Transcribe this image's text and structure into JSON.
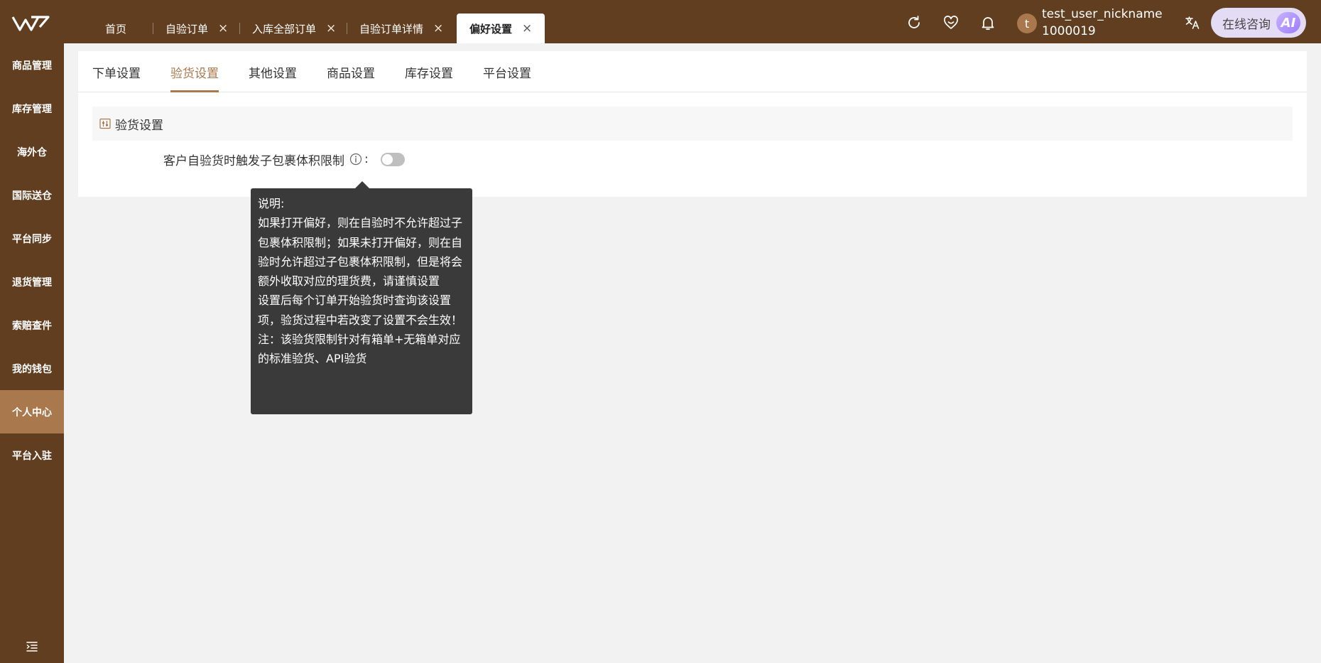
{
  "header": {
    "tabs": [
      {
        "label": "首页",
        "closable": false,
        "active": false
      },
      {
        "label": "自验订单",
        "closable": true,
        "active": false
      },
      {
        "label": "入库全部订单",
        "closable": true,
        "active": false
      },
      {
        "label": "自验订单详情",
        "closable": true,
        "active": false
      },
      {
        "label": "偏好设置",
        "closable": true,
        "active": true
      }
    ],
    "close_glyph": "×",
    "icons": [
      "refresh-icon",
      "heart-icon",
      "bell-icon",
      "translate-icon"
    ],
    "user": {
      "avatar_letter": "t",
      "nickname": "test_user_nickname",
      "id": "1000019"
    },
    "consult_label": "在线咨询",
    "ai_label": "AI"
  },
  "sidebar": {
    "items": [
      {
        "label": "商品管理",
        "active": false
      },
      {
        "label": "库存管理",
        "active": false
      },
      {
        "label": "海外仓",
        "active": false
      },
      {
        "label": "国际送仓",
        "active": false
      },
      {
        "label": "平台同步",
        "active": false
      },
      {
        "label": "退货管理",
        "active": false
      },
      {
        "label": "索赔查件",
        "active": false
      },
      {
        "label": "我的钱包",
        "active": false
      },
      {
        "label": "个人中心",
        "active": true
      },
      {
        "label": "平台入驻",
        "active": false
      }
    ]
  },
  "settings": {
    "subtabs": [
      {
        "label": "下单设置",
        "active": false
      },
      {
        "label": "验货设置",
        "active": true
      },
      {
        "label": "其他设置",
        "active": false
      },
      {
        "label": "商品设置",
        "active": false
      },
      {
        "label": "库存设置",
        "active": false
      },
      {
        "label": "平台设置",
        "active": false
      }
    ],
    "section_title": "验货设置",
    "setting_label": "客户自验货时触发子包裹体积限制",
    "colon": ":",
    "toggle_on": false
  },
  "tooltip": {
    "title": "说明:",
    "line1": "如果打开偏好，则在自验时不允许超过子包裹体积限制；如果未打开偏好，则在自验时允许超过子包裹体积限制，但是将会额外收取对应的理货费，请谨慎设置",
    "line2": "设置后每个订单开始验货时查询该设置项，验货过程中若改变了设置不会生效！",
    "line3": "注：该验货限制针对有箱单+无箱单对应的标准验货、API验货"
  },
  "colors": {
    "brand_brown": "#603e1f",
    "accent": "#a9784c",
    "tooltip_bg": "#3a3a3a"
  }
}
